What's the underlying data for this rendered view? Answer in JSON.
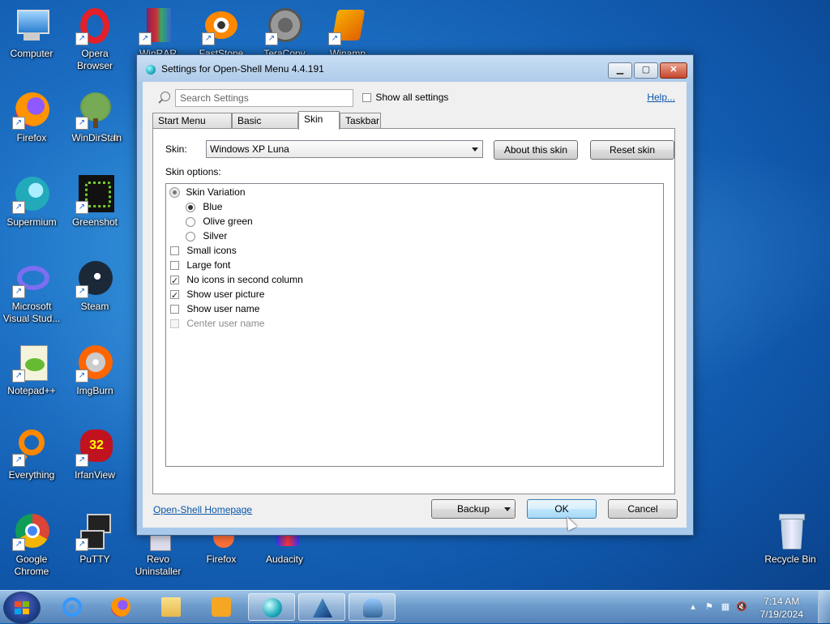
{
  "desktop": {
    "icons": [
      {
        "label": "Computer"
      },
      {
        "label": "Opera Browser"
      },
      {
        "label": "WinRAR"
      },
      {
        "label": "FastStone"
      },
      {
        "label": "TeraCopy"
      },
      {
        "label": "Winamp"
      },
      {
        "label": "Firefox"
      },
      {
        "label": "WinDirStat"
      },
      {
        "label": "In"
      },
      {
        "label": "Supermium"
      },
      {
        "label": "Greenshot"
      },
      {
        "label": "Microsoft Visual Stud..."
      },
      {
        "label": "Steam"
      },
      {
        "label": "Notepad++"
      },
      {
        "label": "ImgBurn"
      },
      {
        "label": "Everything"
      },
      {
        "label": "IrfanView"
      },
      {
        "label": "Google Chrome"
      },
      {
        "label": "PuTTY"
      },
      {
        "label": "Revo Uninstaller"
      },
      {
        "label": "Firefox"
      },
      {
        "label": "Audacity"
      },
      {
        "label": "Recycle Bin"
      }
    ]
  },
  "dialog": {
    "title": "Settings for Open-Shell Menu 4.4.191",
    "search_placeholder": "Search Settings",
    "show_all_label": "Show all settings",
    "help_label": "Help...",
    "tabs": [
      {
        "label": "Start Menu Style"
      },
      {
        "label": "Basic Settings"
      },
      {
        "label": "Skin"
      },
      {
        "label": "Taskbar"
      }
    ],
    "skin_label": "Skin:",
    "skin_value": "Windows XP Luna",
    "about_skin_label": "About this skin",
    "reset_skin_label": "Reset skin",
    "skin_options_label": "Skin options:",
    "options": {
      "variation": "Skin Variation",
      "blue": "Blue",
      "olive": "Olive green",
      "silver": "Silver",
      "small_icons": "Small icons",
      "large_font": "Large font",
      "no_icons_second": "No icons in second column",
      "show_user_picture": "Show user picture",
      "show_user_name": "Show user name",
      "center_user_name": "Center user name"
    },
    "homepage_link": "Open-Shell Homepage",
    "backup_label": "Backup",
    "ok_label": "OK",
    "cancel_label": "Cancel"
  },
  "taskbar": {
    "time": "7:14 AM",
    "date": "7/19/2024"
  }
}
